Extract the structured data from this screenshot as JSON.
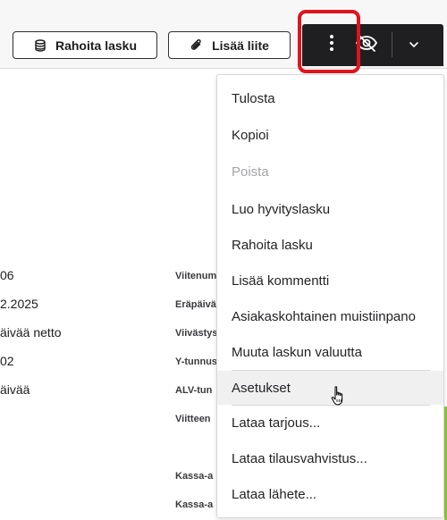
{
  "toolbar": {
    "finance_label": "Rahoita lasku",
    "attach_label": "Lisää liite"
  },
  "invoice_values": [
    "06",
    "2.2025",
    "äivää netto",
    "02",
    "äivää"
  ],
  "field_labels": [
    "Viitenum",
    "Eräpäivä",
    "Viivästys",
    "Y-tunnus",
    "ALV-tun",
    "Viitteen",
    "Kassa-a",
    "Kassa-a"
  ],
  "menu": {
    "items": [
      {
        "label": "Tulosta"
      },
      {
        "label": "Kopioi"
      },
      {
        "label": "Poista"
      },
      {
        "label": "Luo hyvityslasku"
      },
      {
        "label": "Rahoita lasku"
      },
      {
        "label": "Lisää kommentti"
      },
      {
        "label": "Asiakaskohtainen muistiinpano"
      },
      {
        "label": "Muuta laskun valuutta"
      },
      {
        "label": "Asetukset"
      },
      {
        "label": "Lataa tarjous..."
      },
      {
        "label": "Lataa tilausvahvistus..."
      },
      {
        "label": "Lataa lähete..."
      }
    ]
  },
  "colors": {
    "highlight": "#e0141d",
    "dark_toolbar": "#1f1f22",
    "disabled_text": "#a5a5a9",
    "green_accent": "#8dc63f"
  },
  "icons": {
    "finance": "coins-icon",
    "attach": "paperclip-icon",
    "more": "kebab-menu-icon",
    "hide": "eye-off-icon",
    "dropdown": "chevron-down-icon",
    "cursor": "hand-pointer-icon"
  }
}
